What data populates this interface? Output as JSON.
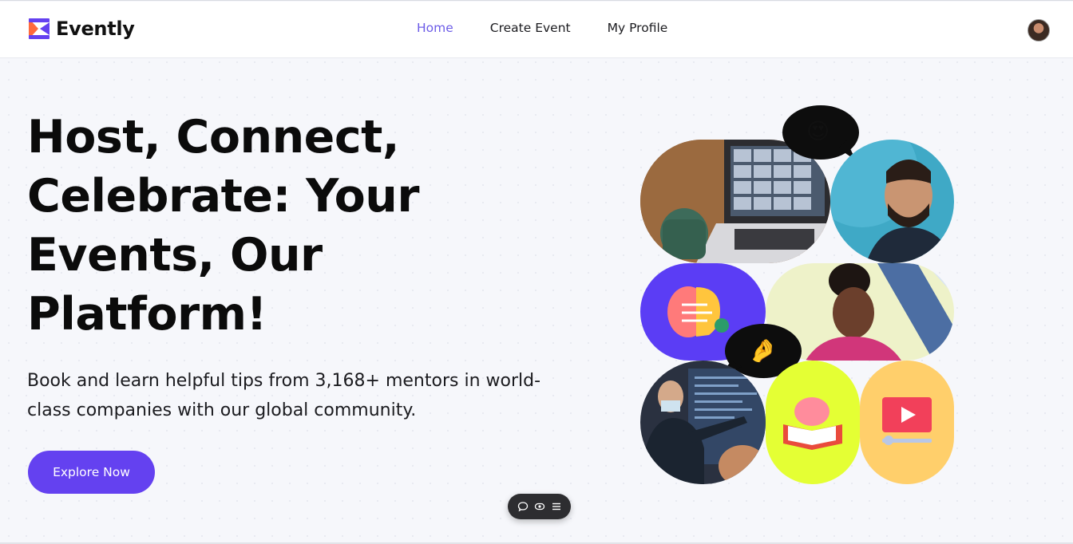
{
  "brand": {
    "name": "Evently",
    "accent": "#6441f0"
  },
  "nav": {
    "items": [
      {
        "label": "Home",
        "active": true
      },
      {
        "label": "Create Event",
        "active": false
      },
      {
        "label": "My Profile",
        "active": false
      }
    ]
  },
  "hero": {
    "title": "Host, Connect, Celebrate: Your Events, Our Platform!",
    "subtitle": "Book and learn helpful tips from 3,168+ mentors in world-class companies with our global community.",
    "cta_label": "Explore Now"
  },
  "collage": {
    "bubble_top_emoji": "😍",
    "bubble_mid_emoji": "🤌"
  },
  "float_toolbar": {
    "icons": [
      "comment-icon",
      "eye-icon",
      "menu-icon"
    ]
  }
}
